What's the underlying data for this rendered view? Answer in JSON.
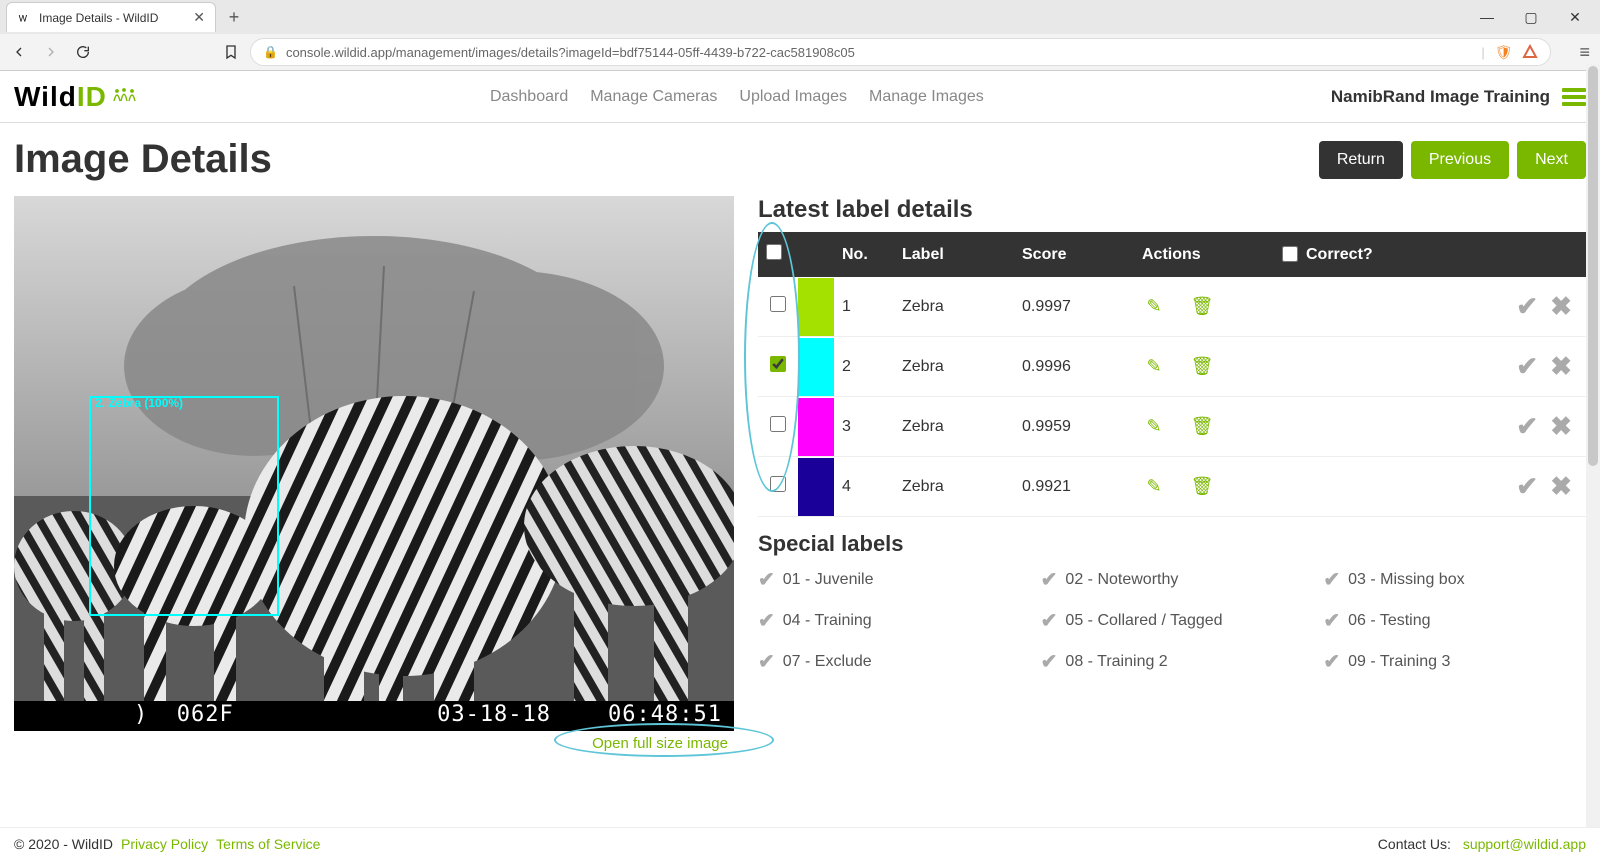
{
  "browser": {
    "tab_title": "Image Details - WildID",
    "url": "console.wildid.app/management/images/details?imageId=bdf75144-05ff-4439-b722-cac581908c05"
  },
  "header": {
    "logo_black": "Wild",
    "logo_green": "ID",
    "nav": {
      "dashboard": "Dashboard",
      "manage_cameras": "Manage Cameras",
      "upload_images": "Upload Images",
      "manage_images": "Manage Images"
    },
    "project_name": "NamibRand Image Training"
  },
  "page": {
    "title": "Image Details",
    "return": "Return",
    "previous": "Previous",
    "next": "Next",
    "full_size_link": "Open full size image"
  },
  "image_overlay": {
    "bbox_label": "2. Zebra (100%)",
    "temp_value": "062F",
    "date": "03-18-18",
    "time": "06:48:51"
  },
  "table": {
    "title": "Latest label details",
    "headers": {
      "no": "No.",
      "label": "Label",
      "score": "Score",
      "actions": "Actions",
      "correct": "Correct?"
    },
    "rows": [
      {
        "no": "1",
        "label": "Zebra",
        "score": "0.9997",
        "swatch": "#a4e100",
        "checked": false
      },
      {
        "no": "2",
        "label": "Zebra",
        "score": "0.9996",
        "swatch": "#00ffff",
        "checked": true
      },
      {
        "no": "3",
        "label": "Zebra",
        "score": "0.9959",
        "swatch": "#ff00ff",
        "checked": false
      },
      {
        "no": "4",
        "label": "Zebra",
        "score": "0.9921",
        "swatch": "#1a0099",
        "checked": false
      }
    ]
  },
  "special": {
    "title": "Special labels",
    "items": [
      "01 - Juvenile",
      "02 - Noteworthy",
      "03 - Missing box",
      "04 - Training",
      "05 - Collared / Tagged",
      "06 - Testing",
      "07 - Exclude",
      "08 - Training 2",
      "09 - Training 3"
    ]
  },
  "footer": {
    "copyright": "© 2020 - WildID",
    "privacy": "Privacy Policy",
    "terms": "Terms of Service",
    "contact_label": "Contact Us:",
    "contact_email": "support@wildid.app"
  }
}
